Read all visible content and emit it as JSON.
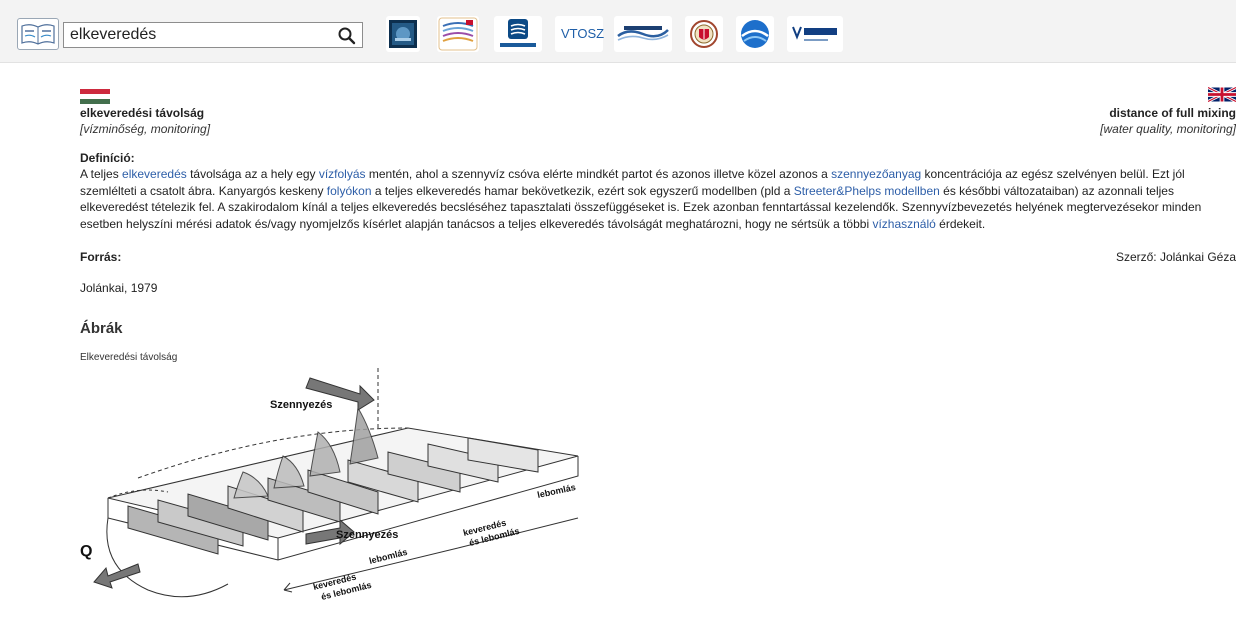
{
  "search": {
    "value": "elkeveredés"
  },
  "partners": {
    "vtosz": "VTOSZ"
  },
  "term": {
    "hu_name": "elkeveredési távolság",
    "hu_category": "[vízminőség, monitoring]",
    "en_name": "distance of full mixing",
    "en_category": "[water quality, monitoring]"
  },
  "definition": {
    "heading": "Definíció:",
    "t1": "A teljes ",
    "l1": "elkeveredés",
    "t2": " távolsága az a hely egy ",
    "l2": "vízfolyás",
    "t3": " mentén, ahol a szennyvíz csóva elérte mindkét partot és azonos illetve közel azonos a ",
    "l3": "szennyezőanyag",
    "t4": " koncentrációja az egész szelvényen belül. Ezt jól szemlélteti a csatolt ábra. Kanyargós keskeny ",
    "l4": "folyókon",
    "t5": " a teljes elkeveredés hamar bekövetkezik, ezért sok egyszerű modellben (pld a ",
    "l5": "Streeter&Phelps modellben",
    "t6": " és későbbi változataiban) az azonnali teljes elkeveredést tételezik fel. A szakirodalom kínál a teljes elkeveredés becsléséhez tapasztalati összefüggéseket is. Ezek azonban fenntartással kezelendők. Szennyvízbevezetés helyének megtervezésekor minden esetben helyszíni mérési adatok és/vagy nyomjelzős kísérlet alapján tanácsos a teljes elkeveredés távolságát meghatározni, hogy ne sértsük a többi ",
    "l6": "vízhasználó",
    "t7": " érdekeit."
  },
  "source": {
    "heading": "Forrás:",
    "author": "Szerző: Jolánkai Géza",
    "reference": "Jolánkai, 1979"
  },
  "figures": {
    "heading": "Ábrák",
    "caption": "Elkeveredési távolság",
    "labels": {
      "pollution_top": "Szennyezés",
      "pollution_side": "Szennyezés",
      "flow": "Q",
      "decay_right": "lebomlás",
      "mix_decay_right_1": "keveredés",
      "mix_decay_right_2": "és lebomlás",
      "decay_mid": "lebomlás",
      "mix_decay_left_1": "keveredés",
      "mix_decay_left_2": "és lebomlás"
    }
  },
  "colors": {
    "link": "#2d5ea8",
    "topbar_bg": "#f3f3f3",
    "hu_red": "#cd2a3e",
    "hu_green": "#436f4d",
    "gb_blue": "#012169",
    "gb_red": "#c8102e"
  },
  "icons": {
    "search": "magnifier-icon",
    "flag_hu": "hungarian-flag-icon",
    "flag_gb": "british-flag-icon"
  }
}
